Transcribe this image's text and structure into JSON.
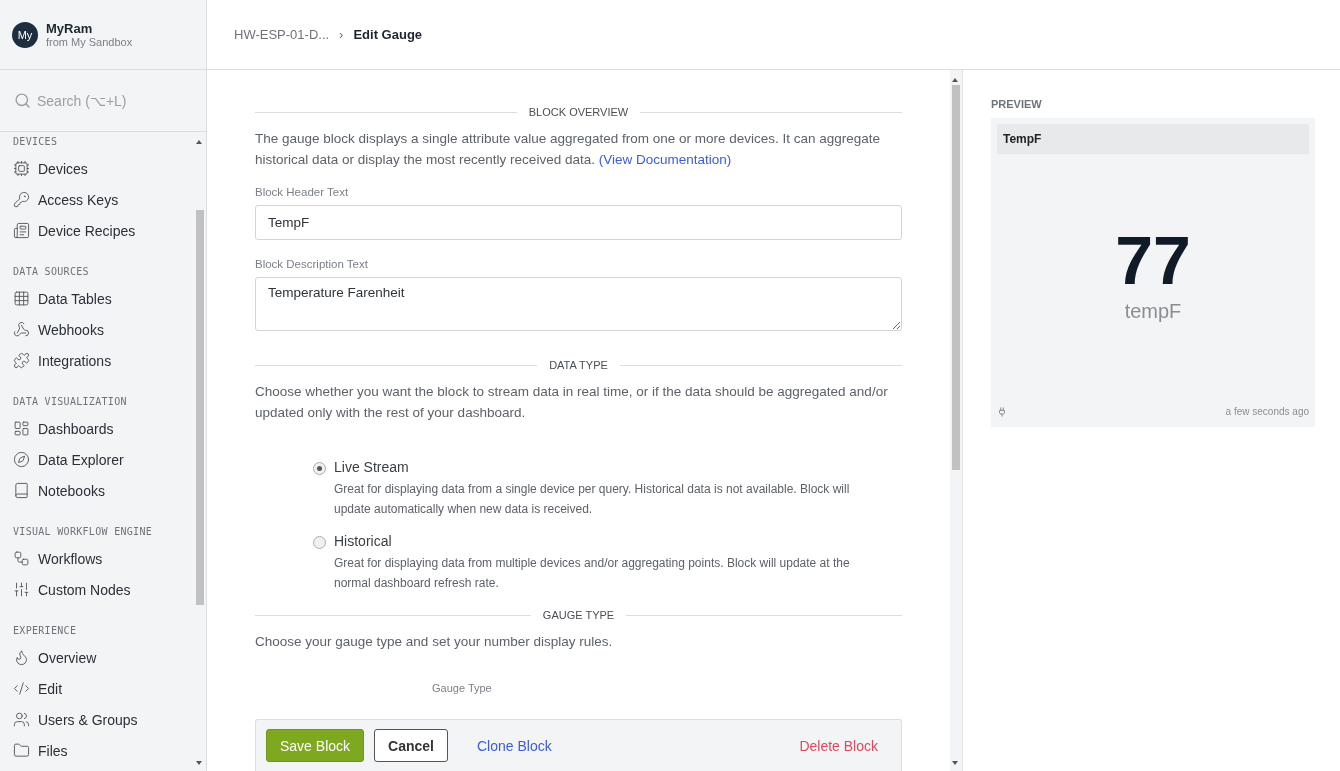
{
  "app": {
    "avatar": "My",
    "name": "MyRam",
    "subtitle": "from My Sandbox"
  },
  "search": {
    "placeholder": "Search (⌥+L)"
  },
  "sidebar": {
    "sections": [
      {
        "title": "DEVICES",
        "items": [
          {
            "label": "Devices"
          },
          {
            "label": "Access Keys"
          },
          {
            "label": "Device Recipes"
          }
        ]
      },
      {
        "title": "DATA SOURCES",
        "items": [
          {
            "label": "Data Tables"
          },
          {
            "label": "Webhooks"
          },
          {
            "label": "Integrations"
          }
        ]
      },
      {
        "title": "DATA VISUALIZATION",
        "items": [
          {
            "label": "Dashboards"
          },
          {
            "label": "Data Explorer"
          },
          {
            "label": "Notebooks"
          }
        ]
      },
      {
        "title": "VISUAL WORKFLOW ENGINE",
        "items": [
          {
            "label": "Workflows"
          },
          {
            "label": "Custom Nodes"
          }
        ]
      },
      {
        "title": "EXPERIENCE",
        "items": [
          {
            "label": "Overview"
          },
          {
            "label": "Edit"
          },
          {
            "label": "Users & Groups"
          },
          {
            "label": "Files"
          }
        ]
      }
    ]
  },
  "breadcrumb": {
    "parent": "HW-ESP-01-D...",
    "separator": "›",
    "current": "Edit Gauge"
  },
  "form": {
    "overview": {
      "heading": "BLOCK OVERVIEW",
      "text": "The gauge block displays a single attribute value aggregated from one or more devices. It can aggregate historical data or display the most recently received data.",
      "link": "(View Documentation)"
    },
    "fields": [
      {
        "label": "Block Header Text",
        "value": "TempF",
        "kind": "input"
      },
      {
        "label": "Block Description Text",
        "value": "Temperature Farenheit",
        "kind": "textarea"
      }
    ],
    "data_type": {
      "heading": "DATA TYPE",
      "text": "Choose whether you want the block to stream data in real time, or if the data should be aggregated and/or updated only with the rest of your dashboard.",
      "options": [
        {
          "label": "Live Stream",
          "description": "Great for displaying data from a single device per query. Historical data is not available. Block will update automatically when new data is received.",
          "selected": true
        },
        {
          "label": "Historical",
          "description": "Great for displaying data from multiple devices and/or aggregating points. Block will update at the normal dashboard refresh rate.",
          "selected": false
        }
      ]
    },
    "gauge_type": {
      "heading": "GAUGE TYPE",
      "text": "Choose your gauge type and set your number display rules.",
      "field_label": "Gauge Type"
    }
  },
  "actions": {
    "save": "Save Block",
    "cancel": "Cancel",
    "clone": "Clone Block",
    "delete": "Delete Block"
  },
  "preview": {
    "title": "PREVIEW",
    "header": "TempF",
    "value": "77",
    "unit": "tempF",
    "time": "a few seconds ago"
  }
}
